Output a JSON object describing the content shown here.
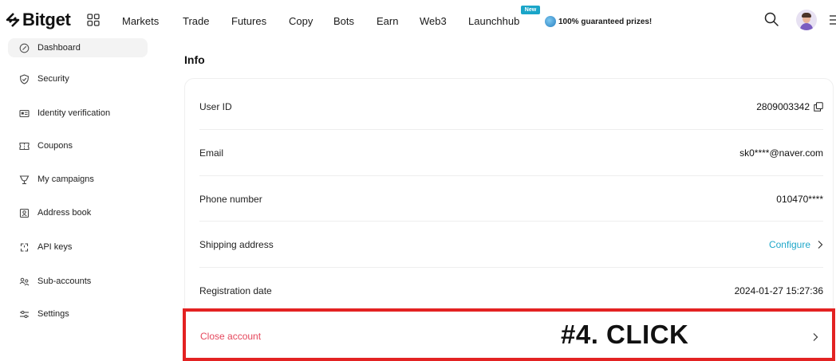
{
  "brand": {
    "name": "Bitget"
  },
  "nav": {
    "items": [
      "Markets",
      "Trade",
      "Futures",
      "Copy",
      "Bots",
      "Earn",
      "Web3",
      "Launchhub"
    ],
    "new_badge": "New",
    "promo": "100% guaranteed prizes!"
  },
  "sidebar": {
    "items": [
      {
        "label": "Dashboard",
        "icon": "dashboard-icon"
      },
      {
        "label": "Security",
        "icon": "shield-icon"
      },
      {
        "label": "Identity verification",
        "icon": "id-card-icon"
      },
      {
        "label": "Coupons",
        "icon": "coupon-icon"
      },
      {
        "label": "My campaigns",
        "icon": "trophy-icon"
      },
      {
        "label": "Address book",
        "icon": "address-book-icon"
      },
      {
        "label": "API keys",
        "icon": "api-key-icon"
      },
      {
        "label": "Sub-accounts",
        "icon": "sub-accounts-icon"
      },
      {
        "label": "Settings",
        "icon": "settings-sliders-icon"
      }
    ]
  },
  "info": {
    "title": "Info",
    "rows": [
      {
        "label": "User ID",
        "value": "2809003342"
      },
      {
        "label": "Email",
        "value": "sk0****@naver.com"
      },
      {
        "label": "Phone number",
        "value": "010470****"
      },
      {
        "label": "Shipping address",
        "value": "Configure"
      },
      {
        "label": "Registration date",
        "value": "2024-01-27 15:27:36"
      }
    ],
    "close_account": "Close account"
  },
  "annotation": {
    "text": "#4. CLICK",
    "color": "#e32222"
  },
  "colors": {
    "accent": "#1fa7c9",
    "danger": "#e5475c"
  }
}
